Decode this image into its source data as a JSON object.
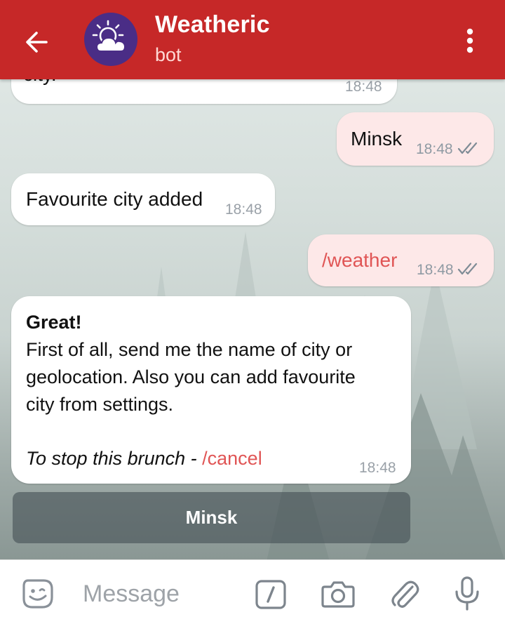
{
  "header": {
    "title": "Weatheric",
    "subtitle": "bot"
  },
  "messages": [
    {
      "text": "city.",
      "time": "18:48"
    },
    {
      "text": "Minsk",
      "time": "18:48"
    },
    {
      "text": "Favourite city added",
      "time": "18:48"
    },
    {
      "text": "/weather",
      "time": "18:48"
    },
    {
      "line1": "Great!",
      "line2": "First of all, send me the name of city or",
      "line3": "geolocation. Also you can add favourite",
      "line4": "city from settings.",
      "line5_prefix": "To stop this brunch - ",
      "line5_command": "/cancel",
      "time": "18:48"
    }
  ],
  "inline_keyboard": {
    "button_label": "Minsk"
  },
  "input": {
    "placeholder": "Message"
  },
  "colors": {
    "header": "#c62828",
    "avatar": "#4a2d86",
    "outgoing_bubble": "#fde8e8",
    "command_link": "#e05555"
  },
  "icons": [
    "back-arrow-icon",
    "sun-cloud-icon",
    "more-vert-icon",
    "double-check-icon",
    "sticker-icon",
    "slash-command-icon",
    "camera-icon",
    "paperclip-icon",
    "microphone-icon"
  ]
}
